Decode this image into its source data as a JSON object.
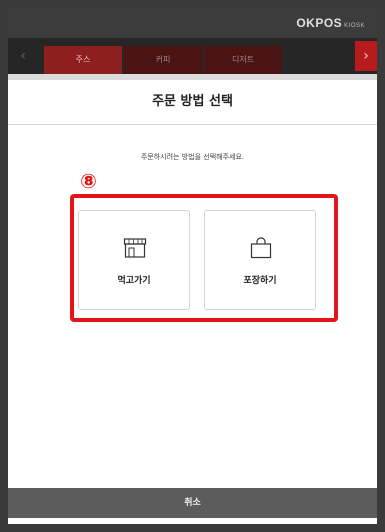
{
  "header": {
    "brand": "OKPOS",
    "brand_sub": "KIOSK"
  },
  "tabs": [
    {
      "label": "주스",
      "active": true
    },
    {
      "label": "커피",
      "active": false
    },
    {
      "label": "디저트",
      "active": false
    }
  ],
  "modal": {
    "title": "주문 방법 선택",
    "instruction": "주문하시려는 방법을 선택해주세요.",
    "step_marker": "⑧",
    "options": [
      {
        "label": "먹고가기",
        "icon": "store-icon"
      },
      {
        "label": "포장하기",
        "icon": "shopping-bag-icon"
      }
    ],
    "cancel_label": "취소"
  },
  "colors": {
    "highlight": "#e3141a",
    "tab_active": "#8e1f1f",
    "cancel_bg": "#5c5c5c"
  }
}
